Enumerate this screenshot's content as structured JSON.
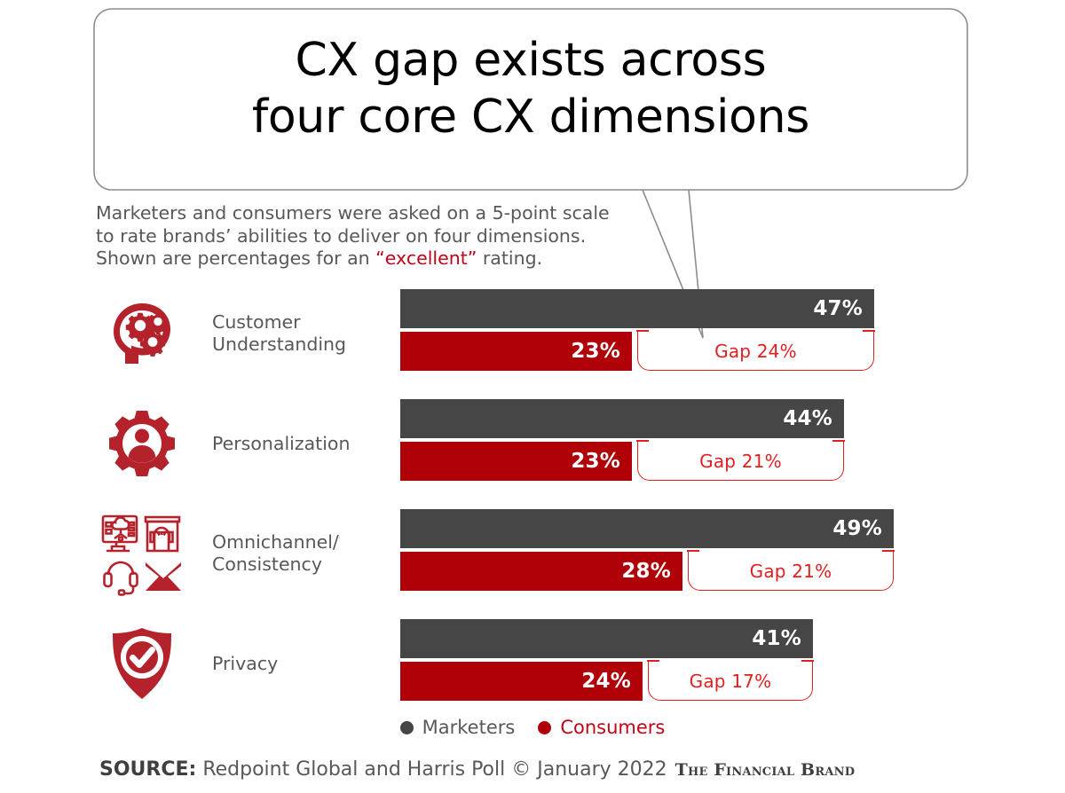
{
  "title": {
    "line1": "CX gap exists across",
    "line2": "four core CX dimensions",
    "full": "CX gap exists across\nfour core CX dimensions"
  },
  "subtitle": {
    "line1": "Marketers and consumers were asked on a 5-point scale",
    "line2": "to rate brands’ abilities to deliver on four dimensions.",
    "line3_pre": "Shown are percentages for an ",
    "line3_highlight": "“excellent”",
    "line3_post": " rating."
  },
  "legend": {
    "marketers": "Marketers",
    "consumers": "Consumers"
  },
  "source": {
    "keyword": "SOURCE:",
    "text": "Redpoint Global and Harris Poll © January 2022",
    "brand": "The Financial Brand"
  },
  "colors": {
    "marketers": "#464646",
    "consumers": "#b00008",
    "gap": "#e02020",
    "icon": "#b4222c",
    "text": "#58585a",
    "highlight": "#c00418"
  },
  "chart_data": {
    "type": "bar",
    "orientation": "horizontal",
    "title": "CX gap exists across four core CX dimensions",
    "subtitle": "Marketers and consumers were asked on a 5-point scale to rate brands’ abilities to deliver on four dimensions. Shown are percentages for an “excellent” rating.",
    "xlabel": "",
    "ylabel": "",
    "unit": "%",
    "xlim": [
      0,
      52
    ],
    "grid": false,
    "legend_position": "bottom-center",
    "categories": [
      "Customer Understanding",
      "Personalization",
      "Omnichannel/Consistency",
      "Privacy"
    ],
    "series": [
      {
        "name": "Marketers",
        "color": "#464646",
        "values": [
          47,
          44,
          49,
          41
        ]
      },
      {
        "name": "Consumers",
        "color": "#b00008",
        "values": [
          23,
          23,
          28,
          24
        ]
      }
    ],
    "gaps": [
      24,
      21,
      21,
      17
    ],
    "source": "SOURCE: Redpoint Global and Harris Poll © January 2022 The Financial Brand"
  },
  "rows": [
    {
      "label": "Customer\nUnderstanding",
      "icon": "head-gears-icon",
      "marketers_value": 47,
      "marketers_label": "47%",
      "consumers_value": 23,
      "consumers_label": "23%",
      "gap_value": 24,
      "gap_label": "Gap 24%"
    },
    {
      "label": "Personalization",
      "icon": "gear-person-icon",
      "marketers_value": 44,
      "marketers_label": "44%",
      "consumers_value": 23,
      "consumers_label": "23%",
      "gap_value": 21,
      "gap_label": "Gap 21%"
    },
    {
      "label": "Omnichannel/\nConsistency",
      "icon": "omnichannel-cluster-icon",
      "marketers_value": 49,
      "marketers_label": "49%",
      "consumers_value": 28,
      "consumers_label": "28%",
      "gap_value": 21,
      "gap_label": "Gap 21%"
    },
    {
      "label": "Privacy",
      "icon": "shield-check-icon",
      "marketers_value": 41,
      "marketers_label": "41%",
      "consumers_value": 24,
      "consumers_label": "24%",
      "gap_value": 17,
      "gap_label": "Gap 17%"
    }
  ]
}
